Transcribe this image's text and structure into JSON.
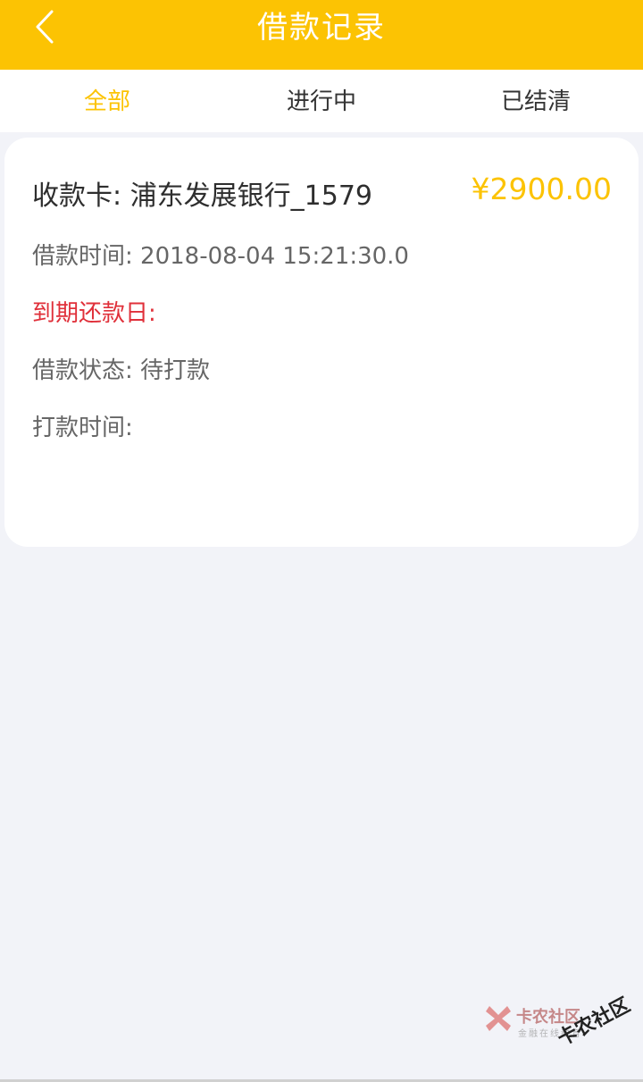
{
  "header": {
    "title": "借款记录",
    "background": "#fcc303",
    "back_icon": "chevron-left-icon"
  },
  "tabs": [
    {
      "label": "全部",
      "active": true
    },
    {
      "label": "进行中",
      "active": false
    },
    {
      "label": "已结清",
      "active": false
    }
  ],
  "record": {
    "bank": "收款卡: 浦东发展银行_1579",
    "amount": "¥2900.00",
    "loan_time": "借款时间: 2018-08-04 15:21:30.0",
    "due_date": "到期还款日:",
    "status": "借款状态: 待打款",
    "payout_time": "打款时间:"
  },
  "watermark": {
    "name": "卡农社区",
    "tagline": "金融在线教育",
    "stamp": "卡农社区"
  },
  "colors": {
    "accent": "#fcc303",
    "due": "#e0303a",
    "background": "#f2f3f8"
  }
}
